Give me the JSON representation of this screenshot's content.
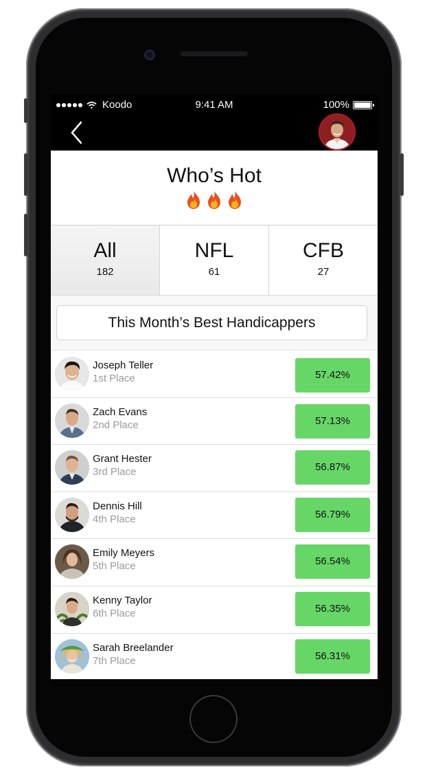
{
  "status_bar": {
    "carrier": "Koodo",
    "time": "9:41 AM",
    "battery": "100%",
    "battery_level": 1.0
  },
  "nav": {
    "back_icon": "chevron-left-icon",
    "avatar_icon": "user-avatar"
  },
  "header": {
    "title": "Who’s Hot",
    "icons": [
      "fire-icon",
      "fire-icon",
      "fire-icon"
    ]
  },
  "tabs": [
    {
      "label": "All",
      "count": "182",
      "active": true
    },
    {
      "label": "NFL",
      "count": "61",
      "active": false
    },
    {
      "label": "CFB",
      "count": "27",
      "active": false
    }
  ],
  "section": {
    "title": "This Month’s Best Handicappers"
  },
  "handicappers": [
    {
      "name": "Joseph Teller",
      "place": "1st Place",
      "percent": "57.42%"
    },
    {
      "name": "Zach Evans",
      "place": "2nd Place",
      "percent": "57.13%"
    },
    {
      "name": "Grant Hester",
      "place": "3rd Place",
      "percent": "56.87%"
    },
    {
      "name": "Dennis Hill",
      "place": "4th Place",
      "percent": "56.79%"
    },
    {
      "name": "Emily Meyers",
      "place": "5th Place",
      "percent": "56.54%"
    },
    {
      "name": "Kenny Taylor",
      "place": "6th Place",
      "percent": "56.35%"
    },
    {
      "name": "Sarah Breelander",
      "place": "7th Place",
      "percent": "56.31%"
    }
  ],
  "colors": {
    "accent_green": "#66d767",
    "place_gray": "#9a9a9a",
    "avatar_border": "#b01c2c"
  }
}
